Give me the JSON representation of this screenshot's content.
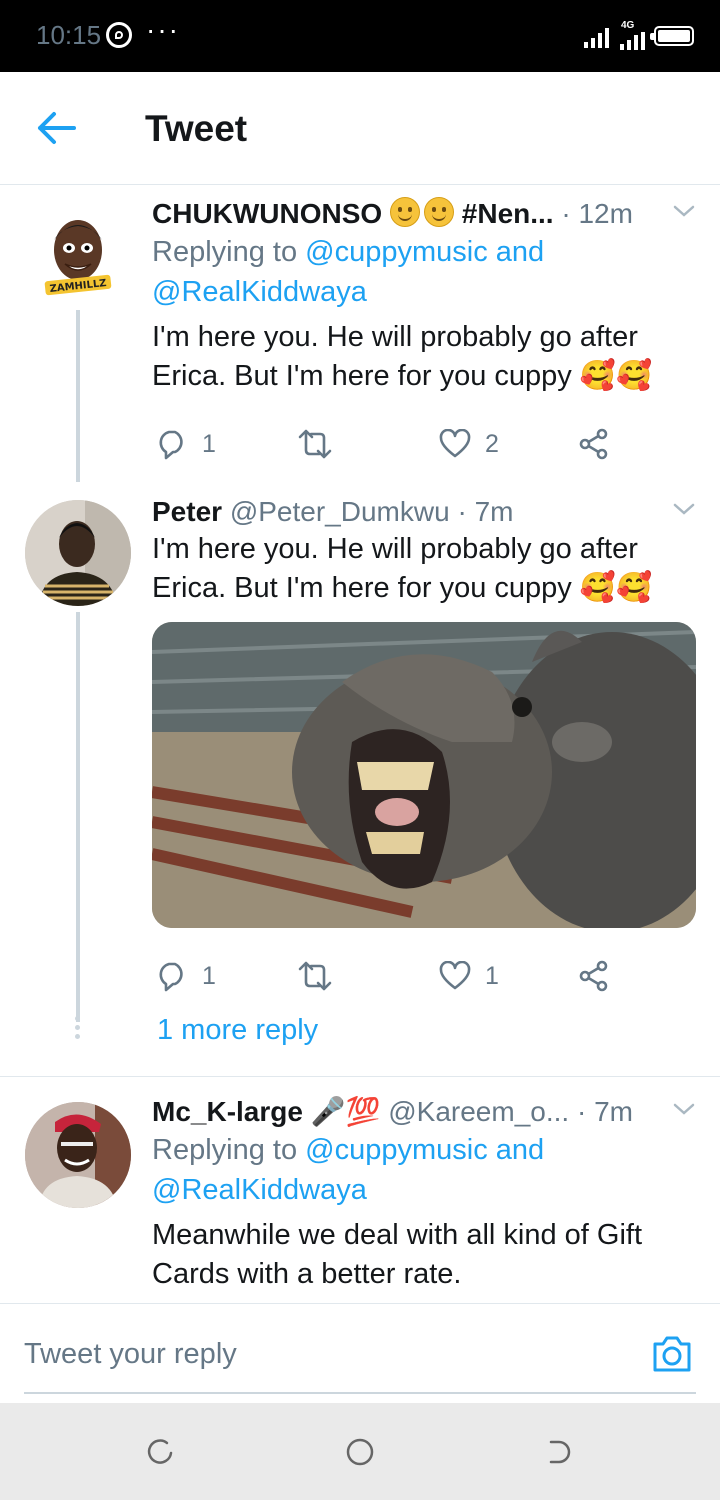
{
  "status_bar": {
    "time": "10:15",
    "more": "···",
    "network": "4G"
  },
  "header": {
    "title": "Tweet"
  },
  "tweets": [
    {
      "name": "CHUKWUNONSO",
      "name_suffix": "#Nen...",
      "dot": "·",
      "time": "12m",
      "replying_prefix": "Replying to",
      "replying_user1": "@cuppymusic and",
      "replying_user2": "@RealKiddwaya",
      "text_line1": "I'm here you. He will probably go after",
      "text_line2": "Erica. But I'm here for you cuppy 🥰🥰",
      "reply_count": "1",
      "like_count": "2",
      "avatar_text": "ZAMHILLZ"
    },
    {
      "name": "Peter",
      "handle": "@Peter_Dumkwu",
      "dot": "·",
      "time": "7m",
      "text_line1": "I'm here you. He will probably go after",
      "text_line2": "Erica. But I'm here for you cuppy 🥰🥰",
      "reply_count": "1",
      "like_count": "1",
      "more_replies": "1 more reply"
    },
    {
      "name": "Mc_K-large",
      "name_emoji": "🎤💯",
      "handle": "@Kareem_o...",
      "dot": "·",
      "time": "7m",
      "replying_prefix": "Replying to",
      "replying_user1": "@cuppymusic and",
      "replying_user2": "@RealKiddwaya",
      "text_line1": "Meanwhile we deal with all kind of Gift",
      "text_line2": "Cards with a better rate."
    }
  ],
  "reply_bar": {
    "placeholder": "Tweet your reply"
  },
  "icons": {
    "back": "back-arrow-icon",
    "chevron": "chevron-down-icon",
    "reply": "reply-icon",
    "retweet": "retweet-icon",
    "like": "heart-icon",
    "share": "share-icon",
    "camera": "camera-icon"
  },
  "colors": {
    "accent": "#1da1f2",
    "secondary_text": "#657786",
    "divider": "#e1e8ed"
  }
}
